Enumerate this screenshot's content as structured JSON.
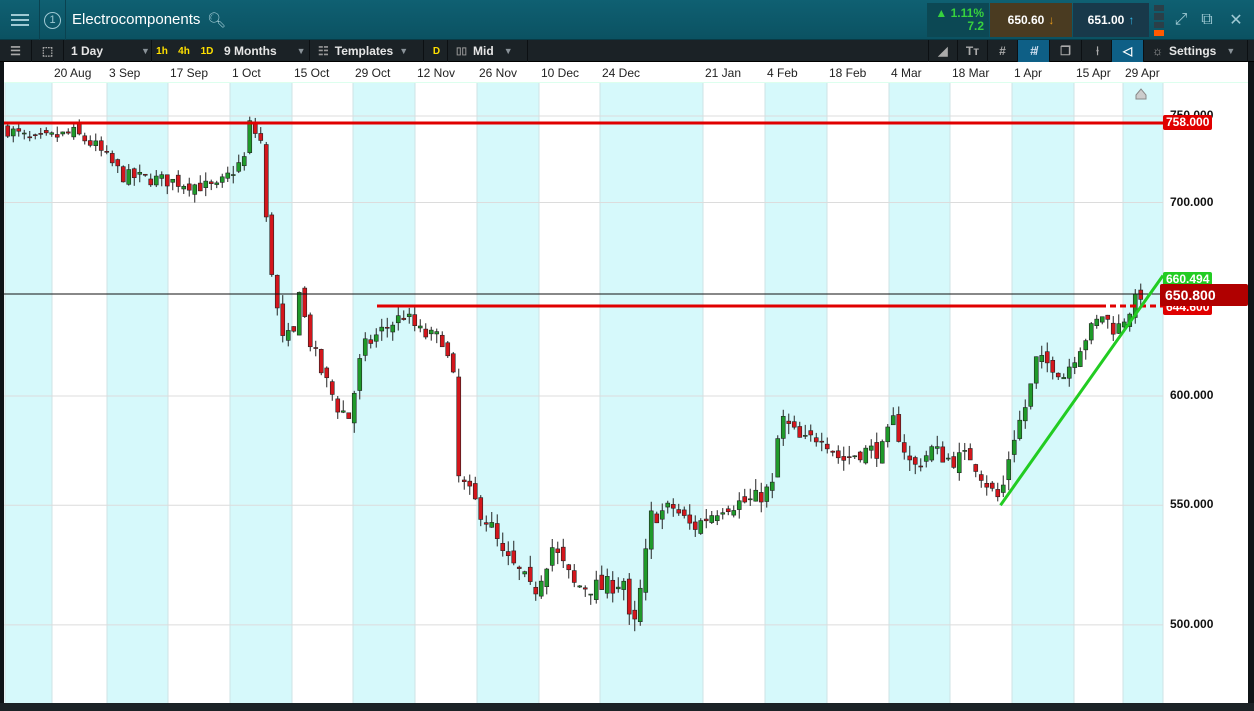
{
  "header": {
    "title": "Electrocomponents",
    "change_pct": "1.11%",
    "change_abs": "7.2",
    "sell": "650.60",
    "buy": "651.00",
    "panel_number": "1"
  },
  "toolbar": {
    "interval": "1 Day",
    "quick": [
      "1h",
      "4h",
      "1D"
    ],
    "range": "9 Months",
    "templates": "Templates",
    "d_label": "D",
    "price_type": "Mid",
    "settings": "Settings"
  },
  "dates": [
    "20 Aug",
    "3 Sep",
    "17 Sep",
    "1 Oct",
    "15 Oct",
    "29 Oct",
    "12 Nov",
    "26 Nov",
    "10 Dec",
    "24 Dec",
    "21 Jan",
    "4 Feb",
    "18 Feb",
    "4 Mar",
    "18 Mar",
    "1 Apr",
    "15 Apr",
    "29 Apr"
  ],
  "axis": {
    "labels": [
      "750.000",
      "700.000",
      "600.000",
      "550.000",
      "500.000"
    ],
    "values": [
      750,
      700,
      600,
      550,
      500
    ]
  },
  "colors": {
    "up": "#1f9a2a",
    "down": "#d4161c",
    "band": "#d6f9fb",
    "resistance": "#e00000",
    "trend": "#22cc22"
  },
  "chart_data": {
    "type": "candlestick",
    "scale": "log",
    "anchors": [
      [
        0,
        742
      ],
      [
        4.5,
        735
      ],
      [
        12,
        740
      ],
      [
        16,
        732
      ],
      [
        21,
        715
      ],
      [
        30,
        712
      ],
      [
        38,
        708
      ],
      [
        43,
        725
      ],
      [
        44,
        745
      ],
      [
        46,
        735
      ],
      [
        47,
        690
      ],
      [
        48.5,
        650
      ],
      [
        50,
        627
      ],
      [
        52,
        630
      ],
      [
        53,
        655
      ],
      [
        54.5,
        630
      ],
      [
        57,
        612
      ],
      [
        60,
        595
      ],
      [
        62,
        590
      ],
      [
        63,
        602
      ],
      [
        64.5,
        623
      ],
      [
        68,
        632
      ],
      [
        72,
        640
      ],
      [
        75.5,
        630
      ],
      [
        79,
        628
      ],
      [
        81,
        608
      ],
      [
        82,
        562
      ],
      [
        84.5,
        553
      ],
      [
        88,
        540
      ],
      [
        90,
        528
      ],
      [
        93.5,
        520
      ],
      [
        95.5,
        512
      ],
      [
        99,
        532
      ],
      [
        103,
        516
      ],
      [
        108,
        515
      ],
      [
        112,
        518
      ],
      [
        113.5,
        493
      ],
      [
        115.5,
        520
      ],
      [
        117,
        545
      ],
      [
        121,
        549
      ],
      [
        124.5,
        540
      ],
      [
        130,
        550
      ],
      [
        135.5,
        552
      ],
      [
        139,
        558
      ],
      [
        140.5,
        590
      ],
      [
        144.5,
        578
      ],
      [
        148,
        582
      ],
      [
        151.5,
        570
      ],
      [
        155,
        574
      ],
      [
        159,
        575
      ],
      [
        161,
        588
      ],
      [
        164.5,
        566
      ],
      [
        168,
        575
      ],
      [
        171.5,
        570
      ],
      [
        175,
        572
      ],
      [
        179,
        556
      ],
      [
        180.5,
        552
      ],
      [
        182.5,
        578
      ],
      [
        185.5,
        598
      ],
      [
        187,
        617
      ],
      [
        190,
        615
      ],
      [
        192,
        610
      ],
      [
        195.5,
        627
      ],
      [
        199,
        640
      ],
      [
        201.5,
        632
      ],
      [
        204.5,
        645
      ],
      [
        206,
        651
      ]
    ],
    "levels": {
      "resistance": "758.000",
      "support": "644.600",
      "trend_end": "660.494",
      "current": "650.800"
    },
    "level_values": {
      "resistance": 745,
      "support": 644.6,
      "trend_start": 550,
      "trend_end": 660.494,
      "current": 650.8
    }
  }
}
